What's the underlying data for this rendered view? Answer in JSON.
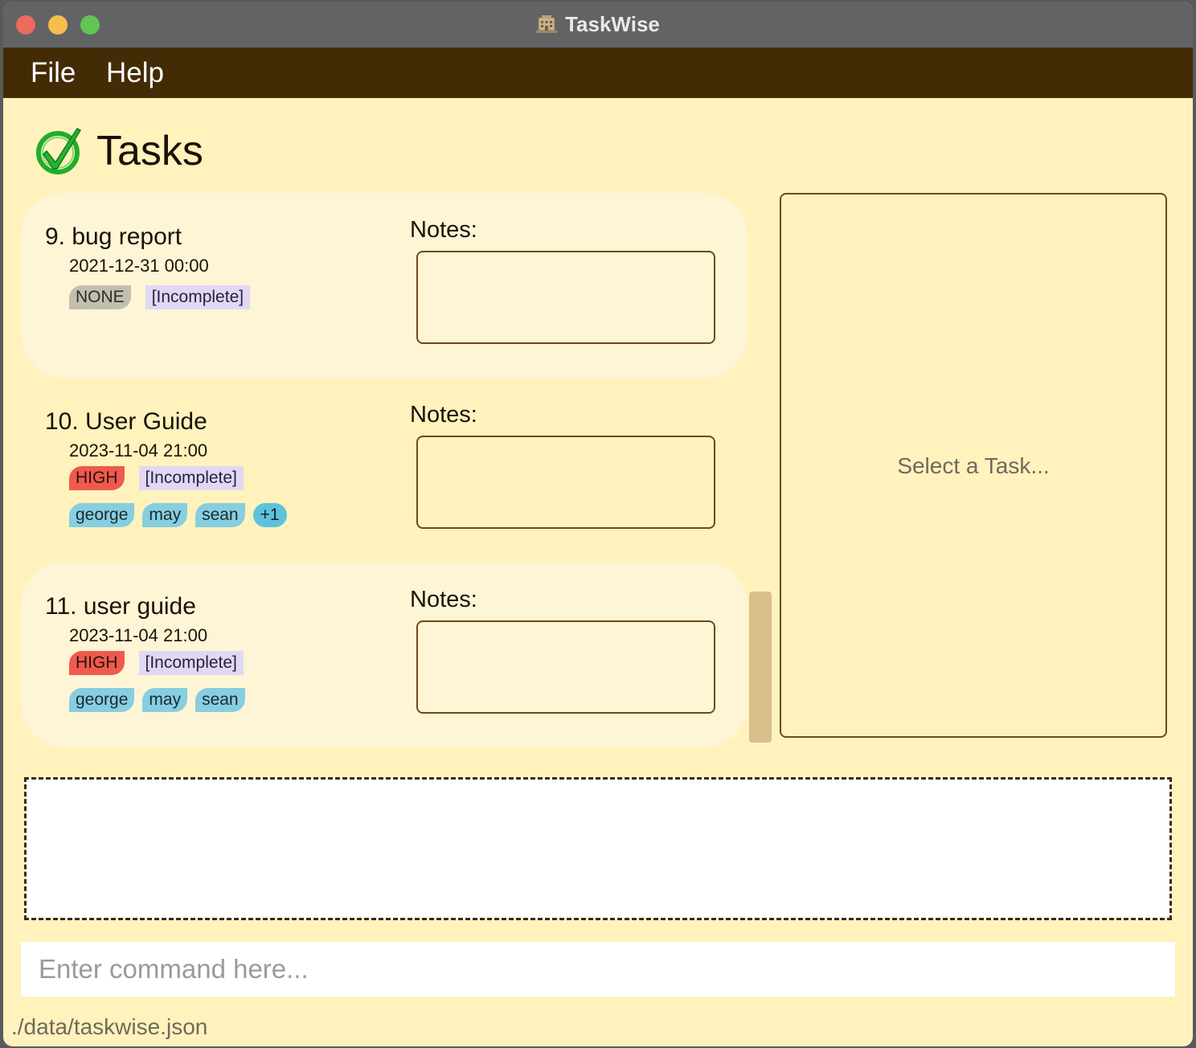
{
  "window": {
    "title": "TaskWise",
    "app_icon": "building-icon",
    "accent": "#432b05",
    "background": "#fff2bd"
  },
  "menu": {
    "items": [
      "File",
      "Help"
    ]
  },
  "tasks": {
    "heading": "Tasks",
    "icon": "check-circle-icon",
    "items": [
      {
        "title": "9. bug report",
        "deadline": "2021-12-31 00:00",
        "priority": "NONE",
        "status": "[Incomplete]",
        "members": [],
        "notes_label": "Notes:",
        "notes": ""
      },
      {
        "title": "10. User Guide",
        "deadline": "2023-11-04 21:00",
        "priority": "HIGH",
        "status": "[Incomplete]",
        "members": [
          "george",
          "may",
          "sean"
        ],
        "more_members": "+1",
        "notes_label": "Notes:",
        "notes": ""
      },
      {
        "title": "11. user guide",
        "deadline": "2023-11-04 21:00",
        "priority": "HIGH",
        "status": "[Incomplete]",
        "members": [
          "george",
          "may",
          "sean"
        ],
        "notes_label": "Notes:",
        "notes": ""
      }
    ]
  },
  "detail": {
    "placeholder": "Select a Task..."
  },
  "result": {
    "text": ""
  },
  "command": {
    "placeholder": "Enter command here...",
    "value": ""
  },
  "status_bar": {
    "path": "./data/taskwise.json"
  }
}
